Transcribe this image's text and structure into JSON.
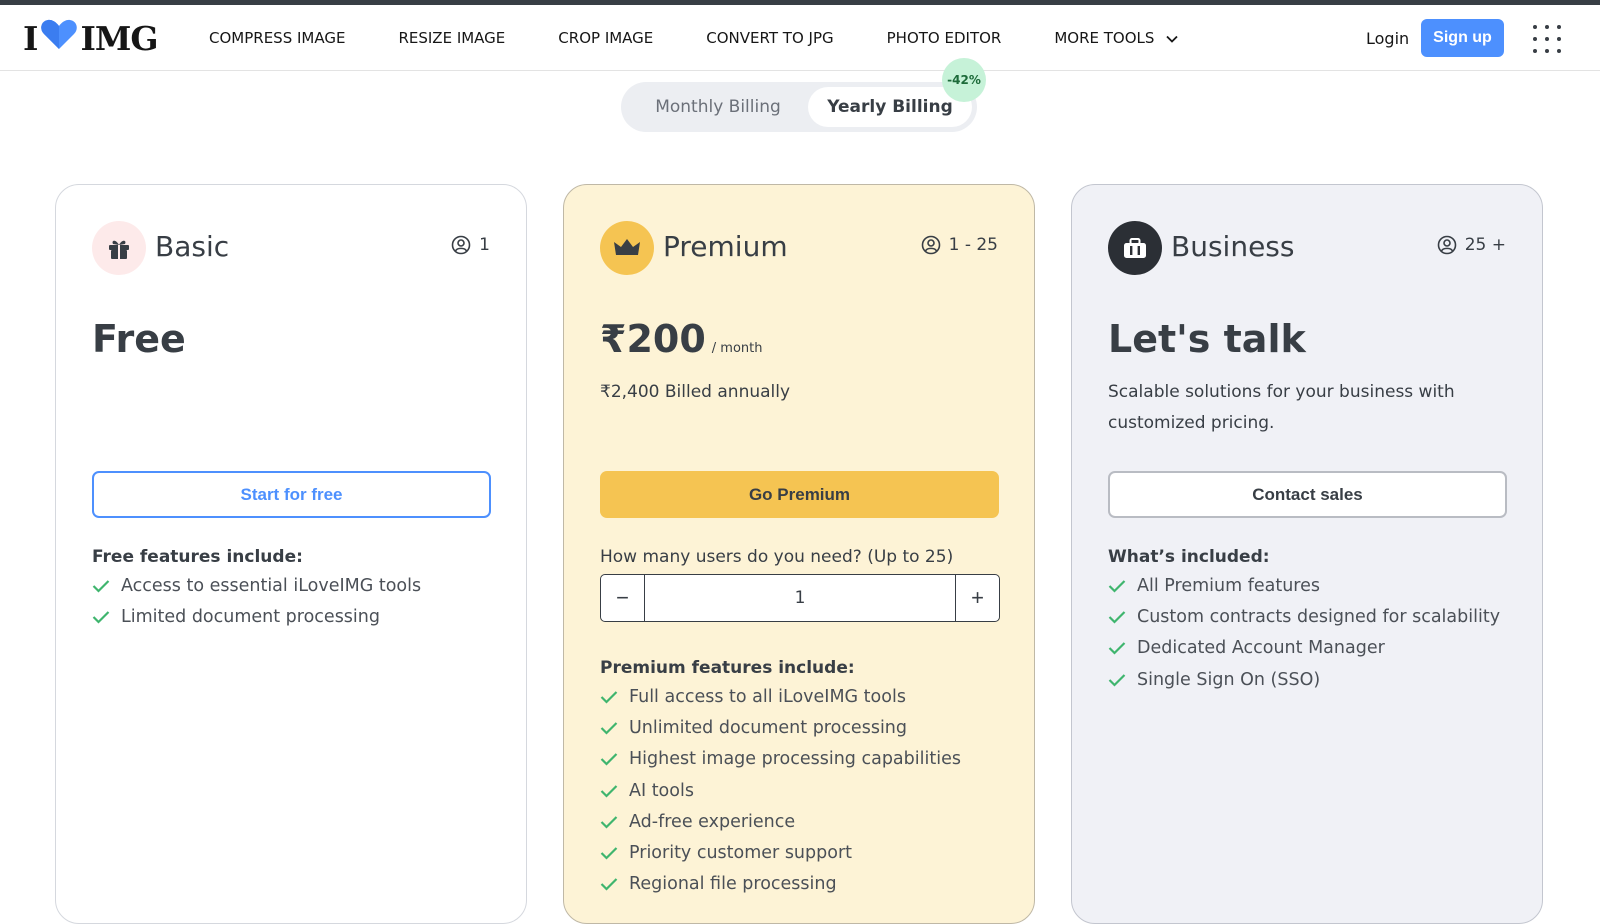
{
  "header": {
    "logo_left": "I",
    "logo_right": "IMG",
    "nav": [
      {
        "label": "COMPRESS IMAGE"
      },
      {
        "label": "RESIZE IMAGE"
      },
      {
        "label": "CROP IMAGE"
      },
      {
        "label": "CONVERT TO JPG"
      },
      {
        "label": "PHOTO EDITOR"
      },
      {
        "label": "MORE TOOLS"
      }
    ],
    "login_label": "Login",
    "signup_label": "Sign up"
  },
  "billing": {
    "monthly_label": "Monthly Billing",
    "yearly_label": "Yearly Billing",
    "selected": "Yearly Billing",
    "discount_badge": "-42%"
  },
  "plans": {
    "basic": {
      "name": "Basic",
      "users": "1",
      "price": "Free",
      "cta": "Start for free",
      "features_title": "Free features include:",
      "features": [
        "Access to essential iLoveIMG tools",
        "Limited document processing"
      ],
      "icon": "gift-icon"
    },
    "premium": {
      "name": "Premium",
      "users": "1 - 25",
      "price": "₹200",
      "price_unit": "/ month",
      "billed": "₹2,400 Billed annually",
      "cta": "Go Premium",
      "users_question": "How many users do you need? (Up to 25)",
      "users_value": "1",
      "minus_label": "−",
      "plus_label": "+",
      "features_title": "Premium features include:",
      "features": [
        "Full access to all iLoveIMG tools",
        "Unlimited document processing",
        "Highest image processing capabilities",
        "AI tools",
        "Ad-free experience",
        "Priority customer support",
        "Regional file processing"
      ],
      "icon": "crown-icon"
    },
    "business": {
      "name": "Business",
      "users": "25 +",
      "price": "Let's talk",
      "description": "Scalable solutions for your business with customized pricing.",
      "cta": "Contact sales",
      "features_title": "What’s included:",
      "features": [
        "All Premium features",
        "Custom contracts designed for scalability",
        "Dedicated Account Manager",
        "Single Sign On (SSO)"
      ],
      "icon": "briefcase-icon"
    }
  },
  "colors": {
    "accent_blue": "#4d90fe",
    "premium_yellow": "#f5c452",
    "check_green": "#3fb56e",
    "text_dark": "#383e45"
  }
}
